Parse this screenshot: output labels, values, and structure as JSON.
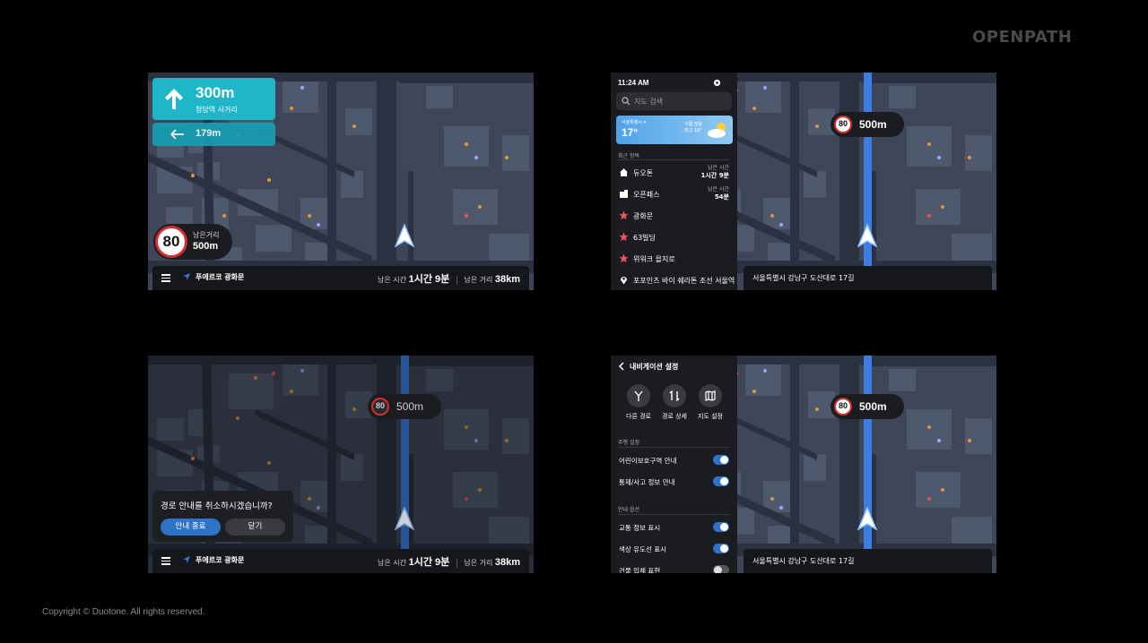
{
  "brand": "OPENPATH",
  "copyright": "Copyright © Duotone. All rights reserved.",
  "colors": {
    "accent_teal": "#1fb6c9",
    "route_blue": "#3b7de0",
    "speed_red": "#d92c2c",
    "toggle_blue": "#2f72c8"
  },
  "panel1": {
    "turn": {
      "icon": "arrow-up-icon",
      "distance": "300m",
      "name": "청담역 사거리"
    },
    "next_turn": {
      "icon": "arrow-left-icon",
      "distance": "179m"
    },
    "speed_limit": "80",
    "remaining_label": "남은거리",
    "remaining_value": "500m",
    "bottom": {
      "destination": "푸에르코 광화문",
      "time_label": "남은 시간",
      "time_value": "1시간 9분",
      "dist_label": "남은 거리",
      "dist_value": "38km"
    }
  },
  "panel2": {
    "time": "11:24 AM",
    "search_placeholder": "지도 검색",
    "weather": {
      "city": "서울특별시 ▾",
      "temp": "17°",
      "desc_line1": "구름 많음",
      "desc_line2": "최고 18°"
    },
    "recent_title": "최근 항목",
    "recent": [
      {
        "icon": "home-icon",
        "label": "듀오톤",
        "meta_label": "남은 시간",
        "meta_value": "1시간 9분"
      },
      {
        "icon": "building-icon",
        "label": "오픈패스",
        "meta_label": "남은 시간",
        "meta_value": "54분"
      },
      {
        "icon": "star-icon",
        "label": "광화문"
      },
      {
        "icon": "star-icon",
        "label": "63빌딩"
      },
      {
        "icon": "star-icon",
        "label": "위워크 을지로"
      },
      {
        "icon": "pin-icon",
        "label": "포포인츠 바이 쉐라톤 조선 서울역"
      }
    ],
    "speed_limit": "80",
    "distance": "500m",
    "address": "서울특별시 강남구 도산대로 17길"
  },
  "panel3": {
    "speed_limit": "80",
    "distance": "500m",
    "dialog": {
      "message": "경로 안내를 취소하시겠습니까?",
      "confirm": "안내 종료",
      "cancel": "닫기"
    },
    "bottom": {
      "destination": "푸에르코 광화문",
      "time_label": "남은 시간",
      "time_value": "1시간 9분",
      "dist_label": "남은 거리",
      "dist_value": "38km"
    }
  },
  "panel4": {
    "title": "내비게이션 설정",
    "quick_actions": [
      {
        "icon": "fork-icon",
        "label": "다른 경로"
      },
      {
        "icon": "swap-icon",
        "label": "경로 상세"
      },
      {
        "icon": "map-icon",
        "label": "지도 설정"
      }
    ],
    "driving_title": "주행 설정",
    "driving": [
      {
        "label": "어린이보호구역 안내",
        "on": true
      },
      {
        "label": "통제/사고 정보 안내",
        "on": true
      }
    ],
    "guide_title": "안내 옵션",
    "guide": [
      {
        "label": "교통 정보 표시",
        "on": true
      },
      {
        "label": "색상 유도선 표시",
        "on": true
      },
      {
        "label": "건물 입체 표현",
        "on": false
      }
    ],
    "speed_limit": "80",
    "distance": "500m",
    "address": "서울특별시 강남구 도산대로 17길"
  }
}
